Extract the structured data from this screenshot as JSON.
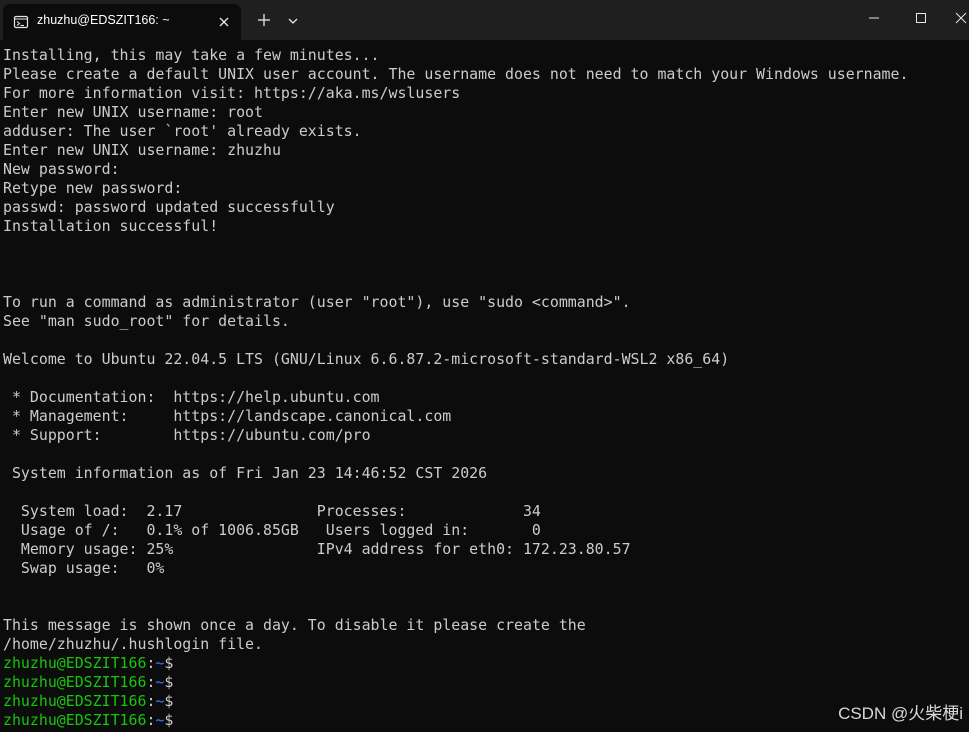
{
  "tab": {
    "title": "zhuzhu@EDSZIT166: ~",
    "icon": "terminal-icon"
  },
  "window_controls": {
    "new_tab_icon": "plus-icon",
    "dropdown_icon": "chevron-down-icon",
    "minimize_icon": "minimize-icon",
    "maximize_icon": "maximize-icon",
    "close_icon": "close-icon"
  },
  "colors": {
    "background": "#0c0c0c",
    "titlebar": "#1f1f1f",
    "text": "#cccccc",
    "prompt_user": "#16c60c",
    "prompt_path": "#3b78ff"
  },
  "terminal": {
    "lines": [
      "Installing, this may take a few minutes...",
      "Please create a default UNIX user account. The username does not need to match your Windows username.",
      "For more information visit: https://aka.ms/wslusers",
      "Enter new UNIX username: root",
      "adduser: The user `root' already exists.",
      "Enter new UNIX username: zhuzhu",
      "New password:",
      "Retype new password:",
      "passwd: password updated successfully",
      "Installation successful!",
      "",
      "",
      "",
      "To run a command as administrator (user \"root\"), use \"sudo <command>\".",
      "See \"man sudo_root\" for details.",
      "",
      "Welcome to Ubuntu 22.04.5 LTS (GNU/Linux 6.6.87.2-microsoft-standard-WSL2 x86_64)",
      "",
      " * Documentation:  https://help.ubuntu.com",
      " * Management:     https://landscape.canonical.com",
      " * Support:        https://ubuntu.com/pro",
      "",
      " System information as of Fri Jan 23 14:46:52 CST 2026",
      "",
      "  System load:  2.17               Processes:             34",
      "  Usage of /:   0.1% of 1006.85GB   Users logged in:       0",
      "  Memory usage: 25%                IPv4 address for eth0: 172.23.80.57",
      "  Swap usage:   0%",
      "",
      "",
      "This message is shown once a day. To disable it please create the",
      "/home/zhuzhu/.hushlogin file."
    ],
    "prompts": [
      {
        "user": "zhuzhu@EDSZIT166",
        "sep": ":",
        "path": "~",
        "sign": "$"
      },
      {
        "user": "zhuzhu@EDSZIT166",
        "sep": ":",
        "path": "~",
        "sign": "$"
      },
      {
        "user": "zhuzhu@EDSZIT166",
        "sep": ":",
        "path": "~",
        "sign": "$"
      },
      {
        "user": "zhuzhu@EDSZIT166",
        "sep": ":",
        "path": "~",
        "sign": "$"
      }
    ]
  },
  "watermark": "CSDN @火柴梗i"
}
